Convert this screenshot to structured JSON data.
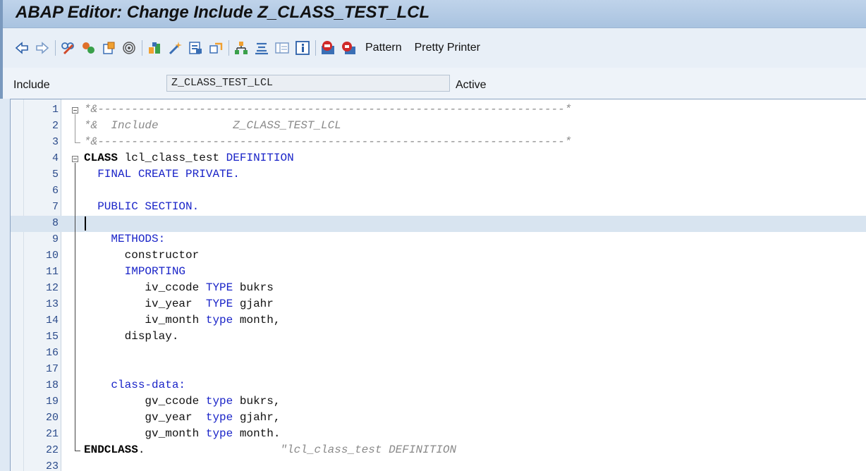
{
  "window": {
    "title": "ABAP Editor: Change Include Z_CLASS_TEST_LCL"
  },
  "toolbar": {
    "icons": [
      "back-arrow-icon",
      "forward-arrow-icon",
      "display-change-icon",
      "activate-icon",
      "other-object-icon",
      "where-used-icon",
      "check-icon",
      "magic-wand-icon",
      "display-object-list-icon",
      "navigate-icon",
      "hierarchy-icon",
      "stack-icon",
      "layout-icon",
      "info-icon",
      "test-icon",
      "debug-icon"
    ],
    "pattern_label": "Pattern",
    "pretty_printer_label": "Pretty Printer"
  },
  "header": {
    "include_label": "Include",
    "include_value": "Z_CLASS_TEST_LCL",
    "status": "Active"
  },
  "editor": {
    "lines": [
      {
        "n": "1",
        "code": "*&---------------------------------------------------------------------*"
      },
      {
        "n": "2",
        "code": "*&  Include           Z_CLASS_TEST_LCL"
      },
      {
        "n": "3",
        "code": "*&---------------------------------------------------------------------*"
      },
      {
        "n": "4",
        "code": "CLASS lcl_class_test DEFINITION"
      },
      {
        "n": "5",
        "code": "  FINAL CREATE PRIVATE."
      },
      {
        "n": "6",
        "code": ""
      },
      {
        "n": "7",
        "code": "  PUBLIC SECTION."
      },
      {
        "n": "8",
        "code": ""
      },
      {
        "n": "9",
        "code": "    METHODS:"
      },
      {
        "n": "10",
        "code": "      constructor"
      },
      {
        "n": "11",
        "code": "      IMPORTING"
      },
      {
        "n": "12",
        "code": "         iv_ccode TYPE bukrs"
      },
      {
        "n": "13",
        "code": "         iv_year  TYPE gjahr"
      },
      {
        "n": "14",
        "code": "         iv_month type month,"
      },
      {
        "n": "15",
        "code": "      display."
      },
      {
        "n": "16",
        "code": ""
      },
      {
        "n": "17",
        "code": ""
      },
      {
        "n": "18",
        "code": "    class-data:"
      },
      {
        "n": "19",
        "code": "         gv_ccode type bukrs,"
      },
      {
        "n": "20",
        "code": "         gv_year  type gjahr,"
      },
      {
        "n": "21",
        "code": "         gv_month type month."
      },
      {
        "n": "22",
        "code": "ENDCLASS.                    \"lcl_class_test DEFINITION"
      },
      {
        "n": "23",
        "code": ""
      }
    ],
    "current_line": "8"
  }
}
